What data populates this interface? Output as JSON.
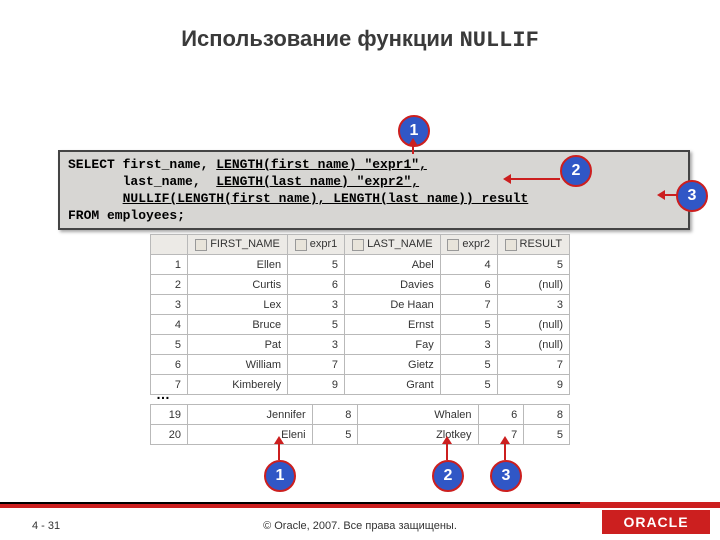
{
  "title": {
    "prefix": "Использование функции",
    "func": "NULLIF"
  },
  "sql": {
    "l1a": "SELECT first_name, ",
    "l1b": "LENGTH(first_name) \"expr1\",",
    "l2a": "       last_name,  ",
    "l2b": "LENGTH(last_name)  \"expr2\",",
    "l3a": "       ",
    "l3b": "NULLIF(LENGTH(first_name), LENGTH(last_name)) result",
    "l4": "FROM   employees;"
  },
  "callouts": {
    "top1": "1",
    "top2": "2",
    "top3": "3",
    "bot1": "1",
    "bot2": "2",
    "bot3": "3"
  },
  "table": {
    "headers": {
      "c1": "FIRST_NAME",
      "c2": "expr1",
      "c3": "LAST_NAME",
      "c4": "expr2",
      "c5": "RESULT"
    },
    "rows1": [
      {
        "n": "1",
        "fn": "Ellen",
        "e1": "5",
        "ln": "Abel",
        "e2": "4",
        "r": "5"
      },
      {
        "n": "2",
        "fn": "Curtis",
        "e1": "6",
        "ln": "Davies",
        "e2": "6",
        "r": "(null)"
      },
      {
        "n": "3",
        "fn": "Lex",
        "e1": "3",
        "ln": "De Haan",
        "e2": "7",
        "r": "3"
      },
      {
        "n": "4",
        "fn": "Bruce",
        "e1": "5",
        "ln": "Ernst",
        "e2": "5",
        "r": "(null)"
      },
      {
        "n": "5",
        "fn": "Pat",
        "e1": "3",
        "ln": "Fay",
        "e2": "3",
        "r": "(null)"
      },
      {
        "n": "6",
        "fn": "William",
        "e1": "7",
        "ln": "Gietz",
        "e2": "5",
        "r": "7"
      },
      {
        "n": "7",
        "fn": "Kimberely",
        "e1": "9",
        "ln": "Grant",
        "e2": "5",
        "r": "9"
      }
    ],
    "rows2": [
      {
        "n": "19",
        "fn": "Jennifer",
        "e1": "8",
        "ln": "Whalen",
        "e2": "6",
        "r": "8"
      },
      {
        "n": "20",
        "fn": "Eleni",
        "e1": "5",
        "ln": "Zlotkey",
        "e2": "7",
        "r": "5"
      }
    ]
  },
  "ellipsis": "…",
  "footer": {
    "left": "4 - 31",
    "center": "© Oracle, 2007. Все права защищены.",
    "brand": "ORACLE"
  }
}
